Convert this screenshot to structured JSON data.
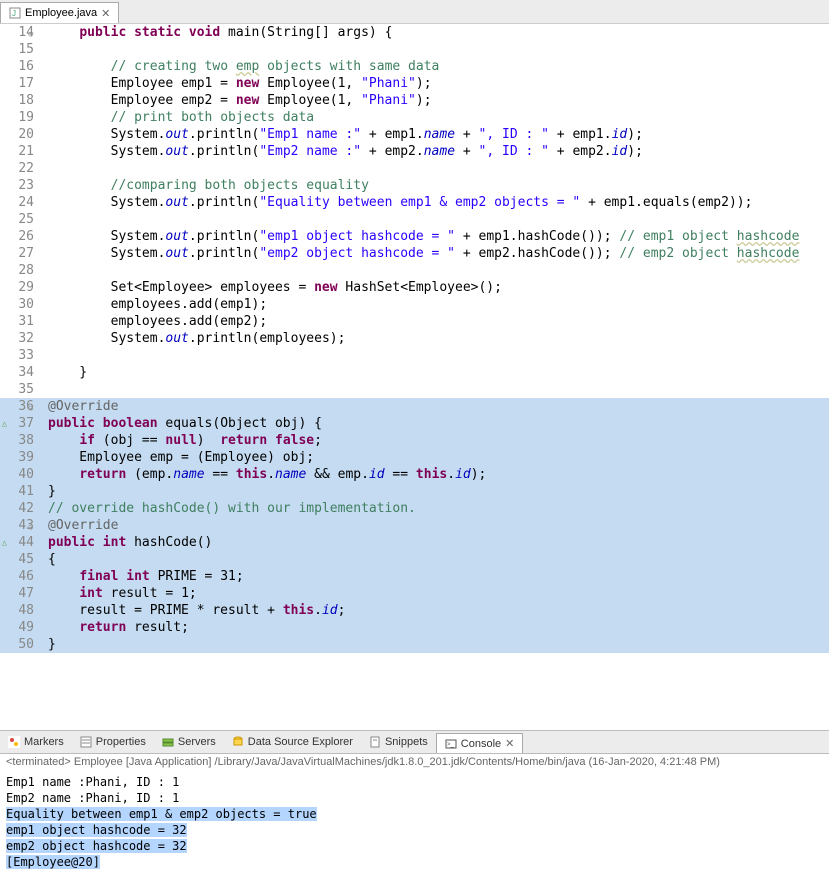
{
  "tab": {
    "title": "Employee.java"
  },
  "code": [
    {
      "n": 14,
      "fold": true,
      "t": [
        {
          "s": "    ",
          "c": ""
        },
        {
          "s": "public static void",
          "c": "kw"
        },
        {
          "s": " main(String[] args) {",
          "c": ""
        }
      ]
    },
    {
      "n": 15,
      "t": [
        {
          "s": "",
          "c": ""
        }
      ]
    },
    {
      "n": 16,
      "t": [
        {
          "s": "        ",
          "c": ""
        },
        {
          "s": "// creating two ",
          "c": "cmt"
        },
        {
          "s": "emp",
          "c": "cmt err"
        },
        {
          "s": " objects with same data",
          "c": "cmt"
        }
      ]
    },
    {
      "n": 17,
      "t": [
        {
          "s": "        Employee emp1 = ",
          "c": ""
        },
        {
          "s": "new",
          "c": "kw"
        },
        {
          "s": " Employee(1, ",
          "c": ""
        },
        {
          "s": "\"Phani\"",
          "c": "str"
        },
        {
          "s": ");",
          "c": ""
        }
      ]
    },
    {
      "n": 18,
      "t": [
        {
          "s": "        Employee emp2 = ",
          "c": ""
        },
        {
          "s": "new",
          "c": "kw"
        },
        {
          "s": " Employee(1, ",
          "c": ""
        },
        {
          "s": "\"Phani\"",
          "c": "str"
        },
        {
          "s": ");",
          "c": ""
        }
      ]
    },
    {
      "n": 19,
      "t": [
        {
          "s": "        ",
          "c": ""
        },
        {
          "s": "// print both objects data",
          "c": "cmt"
        }
      ]
    },
    {
      "n": 20,
      "t": [
        {
          "s": "        System.",
          "c": ""
        },
        {
          "s": "out",
          "c": "fld"
        },
        {
          "s": ".println(",
          "c": ""
        },
        {
          "s": "\"Emp1 name :\"",
          "c": "str"
        },
        {
          "s": " + emp1.",
          "c": ""
        },
        {
          "s": "name",
          "c": "fld"
        },
        {
          "s": " + ",
          "c": ""
        },
        {
          "s": "\", ID : \"",
          "c": "str"
        },
        {
          "s": " + emp1.",
          "c": ""
        },
        {
          "s": "id",
          "c": "fld"
        },
        {
          "s": ");",
          "c": ""
        }
      ]
    },
    {
      "n": 21,
      "t": [
        {
          "s": "        System.",
          "c": ""
        },
        {
          "s": "out",
          "c": "fld"
        },
        {
          "s": ".println(",
          "c": ""
        },
        {
          "s": "\"Emp2 name :\"",
          "c": "str"
        },
        {
          "s": " + emp2.",
          "c": ""
        },
        {
          "s": "name",
          "c": "fld"
        },
        {
          "s": " + ",
          "c": ""
        },
        {
          "s": "\", ID : \"",
          "c": "str"
        },
        {
          "s": " + emp2.",
          "c": ""
        },
        {
          "s": "id",
          "c": "fld"
        },
        {
          "s": ");",
          "c": ""
        }
      ]
    },
    {
      "n": 22,
      "t": [
        {
          "s": "",
          "c": ""
        }
      ]
    },
    {
      "n": 23,
      "t": [
        {
          "s": "        ",
          "c": ""
        },
        {
          "s": "//comparing both objects equality",
          "c": "cmt"
        }
      ]
    },
    {
      "n": 24,
      "t": [
        {
          "s": "        System.",
          "c": ""
        },
        {
          "s": "out",
          "c": "fld"
        },
        {
          "s": ".println(",
          "c": ""
        },
        {
          "s": "\"Equality between emp1 & emp2 objects = \"",
          "c": "str"
        },
        {
          "s": " + emp1.equals(emp2));",
          "c": ""
        }
      ]
    },
    {
      "n": 25,
      "t": [
        {
          "s": "",
          "c": ""
        }
      ]
    },
    {
      "n": 26,
      "t": [
        {
          "s": "        System.",
          "c": ""
        },
        {
          "s": "out",
          "c": "fld"
        },
        {
          "s": ".println(",
          "c": ""
        },
        {
          "s": "\"emp1 object hashcode = \"",
          "c": "str"
        },
        {
          "s": " + emp1.hashCode()); ",
          "c": ""
        },
        {
          "s": "// emp1 object ",
          "c": "cmt"
        },
        {
          "s": "hashcode",
          "c": "cmt err"
        }
      ]
    },
    {
      "n": 27,
      "t": [
        {
          "s": "        System.",
          "c": ""
        },
        {
          "s": "out",
          "c": "fld"
        },
        {
          "s": ".println(",
          "c": ""
        },
        {
          "s": "\"emp2 object hashcode = \"",
          "c": "str"
        },
        {
          "s": " + emp2.hashCode()); ",
          "c": ""
        },
        {
          "s": "// emp2 object ",
          "c": "cmt"
        },
        {
          "s": "hashcode",
          "c": "cmt err"
        }
      ]
    },
    {
      "n": 28,
      "t": [
        {
          "s": "",
          "c": ""
        }
      ]
    },
    {
      "n": 29,
      "t": [
        {
          "s": "        Set<Employee> employees = ",
          "c": ""
        },
        {
          "s": "new",
          "c": "kw"
        },
        {
          "s": " HashSet<Employee>();",
          "c": ""
        }
      ]
    },
    {
      "n": 30,
      "t": [
        {
          "s": "        employees.add(emp1);",
          "c": ""
        }
      ]
    },
    {
      "n": 31,
      "t": [
        {
          "s": "        employees.add(emp2);",
          "c": ""
        }
      ]
    },
    {
      "n": 32,
      "t": [
        {
          "s": "        System.",
          "c": ""
        },
        {
          "s": "out",
          "c": "fld"
        },
        {
          "s": ".println(employees);",
          "c": ""
        }
      ]
    },
    {
      "n": 33,
      "t": [
        {
          "s": "",
          "c": ""
        }
      ]
    },
    {
      "n": 34,
      "t": [
        {
          "s": "    }",
          "c": ""
        }
      ]
    },
    {
      "n": 35,
      "t": [
        {
          "s": "",
          "c": ""
        }
      ]
    },
    {
      "n": 36,
      "hl": true,
      "fold": true,
      "t": [
        {
          "s": "@Override",
          "c": "ann"
        }
      ]
    },
    {
      "n": 37,
      "hl": true,
      "ov": true,
      "t": [
        {
          "s": "public boolean",
          "c": "kw"
        },
        {
          "s": " equals(Object obj) {",
          "c": ""
        }
      ]
    },
    {
      "n": 38,
      "hl": true,
      "t": [
        {
          "s": "    ",
          "c": ""
        },
        {
          "s": "if",
          "c": "kw"
        },
        {
          "s": " (obj == ",
          "c": ""
        },
        {
          "s": "null",
          "c": "kw"
        },
        {
          "s": ")  ",
          "c": ""
        },
        {
          "s": "return false",
          "c": "kw"
        },
        {
          "s": ";",
          "c": ""
        }
      ]
    },
    {
      "n": 39,
      "hl": true,
      "t": [
        {
          "s": "    Employee emp = (Employee) obj;",
          "c": ""
        }
      ]
    },
    {
      "n": 40,
      "hl": true,
      "t": [
        {
          "s": "    ",
          "c": ""
        },
        {
          "s": "return",
          "c": "kw"
        },
        {
          "s": " (emp.",
          "c": ""
        },
        {
          "s": "name",
          "c": "fld"
        },
        {
          "s": " == ",
          "c": ""
        },
        {
          "s": "this",
          "c": "kw"
        },
        {
          "s": ".",
          "c": ""
        },
        {
          "s": "name",
          "c": "fld"
        },
        {
          "s": " && emp.",
          "c": ""
        },
        {
          "s": "id",
          "c": "fld"
        },
        {
          "s": " == ",
          "c": ""
        },
        {
          "s": "this",
          "c": "kw"
        },
        {
          "s": ".",
          "c": ""
        },
        {
          "s": "id",
          "c": "fld"
        },
        {
          "s": ");",
          "c": ""
        }
      ]
    },
    {
      "n": 41,
      "hl": true,
      "t": [
        {
          "s": "}",
          "c": ""
        }
      ]
    },
    {
      "n": 42,
      "hl": true,
      "t": [
        {
          "s": "// override hashCode() with our implementation.",
          "c": "cmt"
        }
      ]
    },
    {
      "n": 43,
      "hl": true,
      "fold": true,
      "t": [
        {
          "s": "@Override",
          "c": "ann"
        }
      ]
    },
    {
      "n": 44,
      "hl": true,
      "ov": true,
      "t": [
        {
          "s": "public int",
          "c": "kw"
        },
        {
          "s": " hashCode()",
          "c": ""
        }
      ]
    },
    {
      "n": 45,
      "hl": true,
      "t": [
        {
          "s": "{",
          "c": ""
        }
      ]
    },
    {
      "n": 46,
      "hl": true,
      "t": [
        {
          "s": "    ",
          "c": ""
        },
        {
          "s": "final int",
          "c": "kw"
        },
        {
          "s": " PRIME = 31;",
          "c": ""
        }
      ]
    },
    {
      "n": 47,
      "hl": true,
      "t": [
        {
          "s": "    ",
          "c": ""
        },
        {
          "s": "int",
          "c": "kw"
        },
        {
          "s": " result = 1;",
          "c": ""
        }
      ]
    },
    {
      "n": 48,
      "hl": true,
      "t": [
        {
          "s": "    result = PRIME * result + ",
          "c": ""
        },
        {
          "s": "this",
          "c": "kw"
        },
        {
          "s": ".",
          "c": ""
        },
        {
          "s": "id",
          "c": "fld"
        },
        {
          "s": ";",
          "c": ""
        }
      ]
    },
    {
      "n": 49,
      "hl": true,
      "t": [
        {
          "s": "    ",
          "c": ""
        },
        {
          "s": "return",
          "c": "kw"
        },
        {
          "s": " result;",
          "c": ""
        }
      ]
    },
    {
      "n": 50,
      "hl": true,
      "t": [
        {
          "s": "}",
          "c": ""
        }
      ]
    }
  ],
  "bottomTabs": [
    {
      "label": "Markers",
      "active": false
    },
    {
      "label": "Properties",
      "active": false
    },
    {
      "label": "Servers",
      "active": false
    },
    {
      "label": "Data Source Explorer",
      "active": false
    },
    {
      "label": "Snippets",
      "active": false
    },
    {
      "label": "Console",
      "active": true
    }
  ],
  "consoleHeader": "<terminated> Employee [Java Application] /Library/Java/JavaVirtualMachines/jdk1.8.0_201.jdk/Contents/Home/bin/java (16-Jan-2020, 4:21:48 PM)",
  "consoleLines": [
    {
      "t": "Emp1 name :Phani, ID : 1",
      "sel": false
    },
    {
      "t": "Emp2 name :Phani, ID : 1",
      "sel": false
    },
    {
      "t": "Equality between emp1 & emp2 objects = true",
      "sel": true
    },
    {
      "t": "emp1 object hashcode = 32",
      "sel": true
    },
    {
      "t": "emp2 object hashcode = 32",
      "sel": true
    },
    {
      "t": "[Employee@20]",
      "sel": true
    }
  ]
}
